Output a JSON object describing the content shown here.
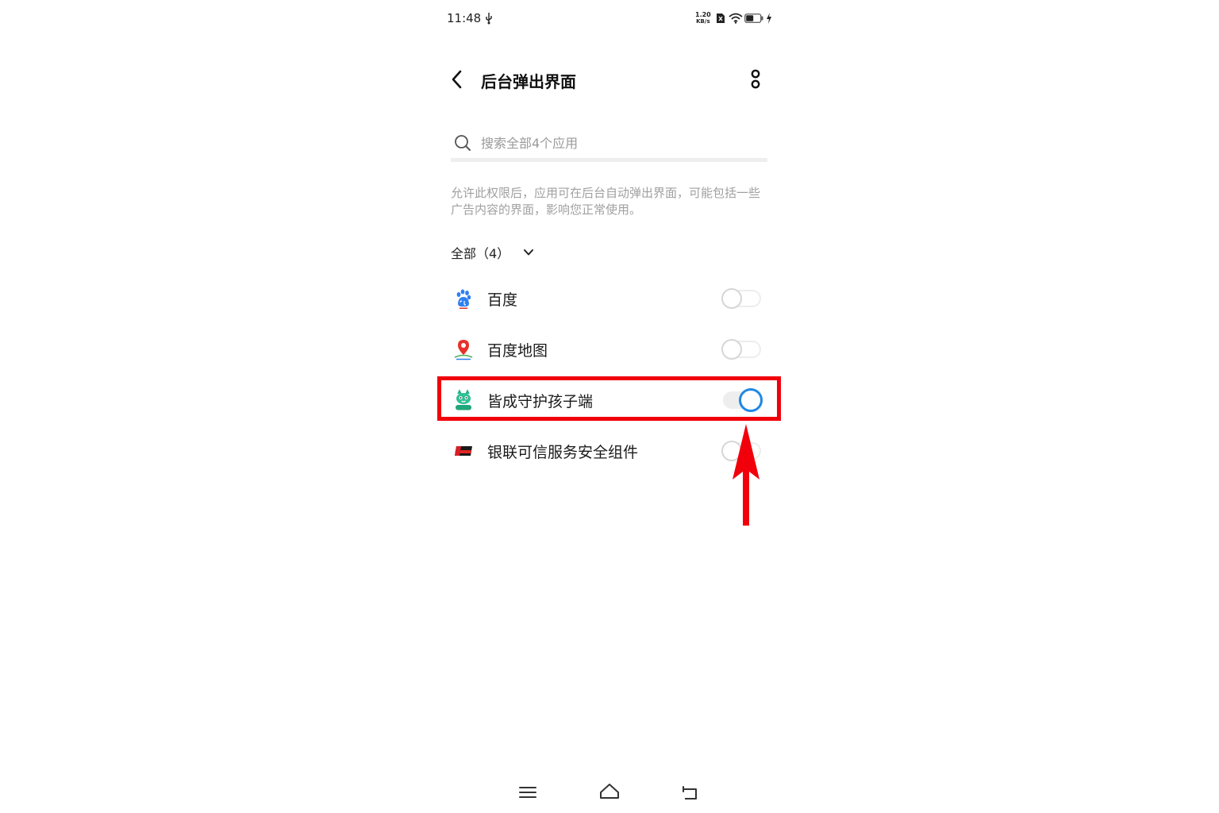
{
  "status_bar": {
    "time": "11:48",
    "net_speed_value": "1.20",
    "net_speed_unit": "KB/s"
  },
  "header": {
    "title": "后台弹出界面"
  },
  "search": {
    "placeholder": "搜索全部4个应用",
    "value": ""
  },
  "description": "允许此权限后，应用可在后台自动弹出界面，可能包括一些广告内容的界面，影响您正常使用。",
  "filter": {
    "label": "全部（4）"
  },
  "apps": [
    {
      "name": "百度",
      "enabled": false,
      "icon": "baidu-paw-icon"
    },
    {
      "name": "百度地图",
      "enabled": false,
      "icon": "baidu-map-pin-icon"
    },
    {
      "name": "皆成守护孩子端",
      "enabled": true,
      "icon": "kids-guardian-icon"
    },
    {
      "name": "银联可信服务安全组件",
      "enabled": false,
      "icon": "unionpay-card-icon"
    }
  ],
  "colors": {
    "accent": "#1e88e5",
    "annotation": "#f1000b"
  }
}
